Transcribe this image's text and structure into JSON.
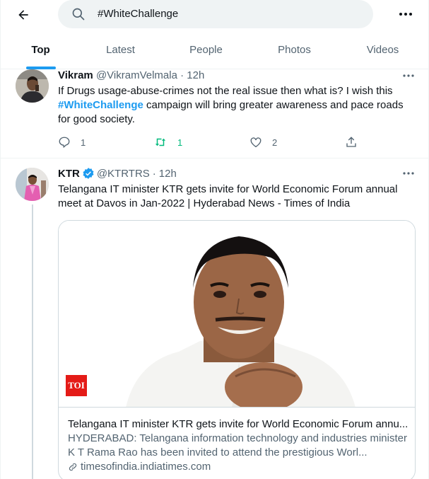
{
  "search": {
    "query": "#WhiteChallenge"
  },
  "icons": {
    "back": "arrow-left-icon",
    "search": "search-icon",
    "more": "more-horizontal-icon",
    "reply": "reply-icon",
    "retweet": "retweet-icon",
    "like": "heart-icon",
    "share": "share-icon",
    "verified": "verified-badge-icon",
    "link": "link-icon"
  },
  "tabs": [
    {
      "label": "Top",
      "active": true
    },
    {
      "label": "Latest",
      "active": false
    },
    {
      "label": "People",
      "active": false
    },
    {
      "label": "Photos",
      "active": false
    },
    {
      "label": "Videos",
      "active": false
    }
  ],
  "tweets": [
    {
      "name": "Vikram",
      "handle": "@VikramVelmala",
      "time": "12h",
      "text_before": "If Drugs usage-abuse-crimes not the real issue then what is? I wish this ",
      "hashtag": "#WhiteChallenge",
      "text_after": " campaign will bring greater awareness and pace roads for good society.",
      "replies": "1",
      "retweets": "1",
      "likes": "2"
    },
    {
      "name": "KTR",
      "handle": "@KTRTRS",
      "time": "12h",
      "text": "Telangana IT minister KTR gets invite for World Economic Forum annual meet at Davos in Jan-2022 | Hyderabad News - Times of India",
      "card": {
        "badge": "TOI",
        "title": "Telangana IT minister KTR gets invite for World Economic Forum annu...",
        "description": "HYDERABAD: Telangana information technology and industries minister K T Rama Rao has been invited to attend the prestigious Worl...",
        "domain": "timesofindia.indiatimes.com"
      }
    }
  ],
  "colors": {
    "accent": "#1d9bf0",
    "retweet_active": "#00ba7c",
    "secondary_text": "#536471",
    "toi_red": "#e41b17"
  }
}
